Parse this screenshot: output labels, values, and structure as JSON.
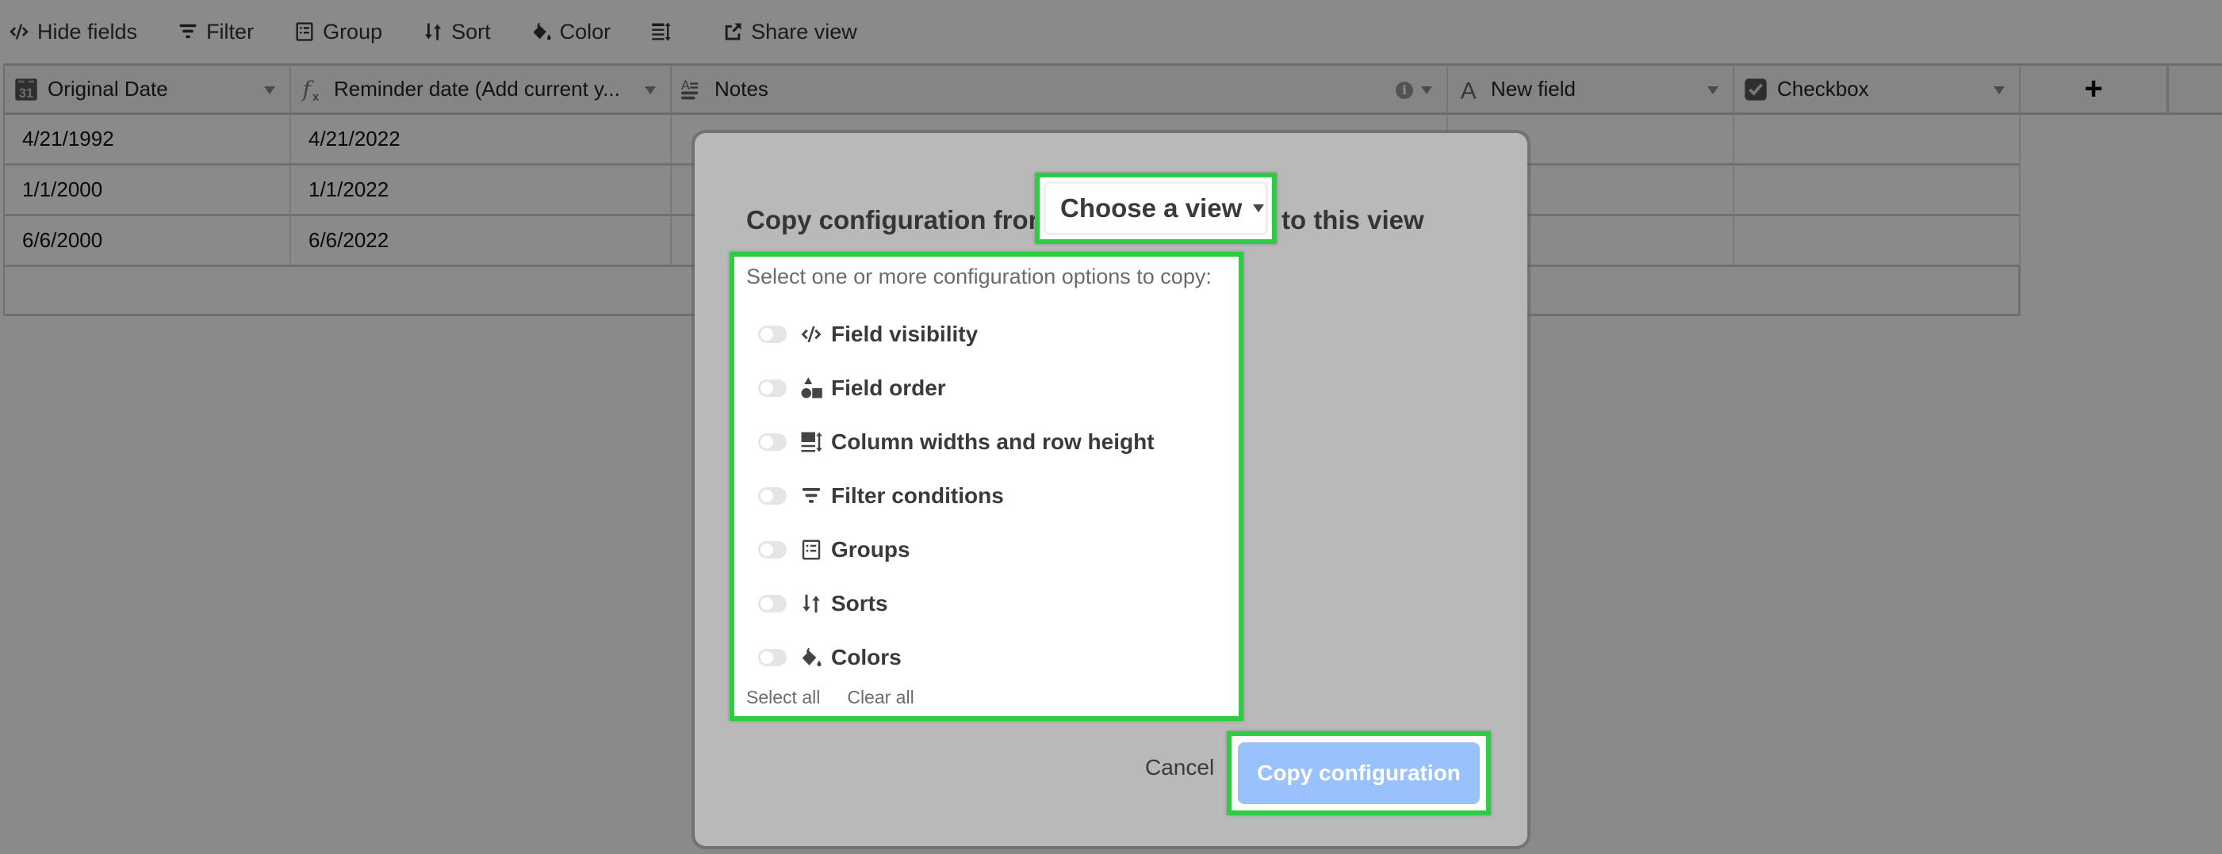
{
  "toolbar": {
    "items": [
      {
        "label": "Hide fields",
        "icon": "hide-fields-icon"
      },
      {
        "label": "Filter",
        "icon": "filter-icon"
      },
      {
        "label": "Group",
        "icon": "group-icon"
      },
      {
        "label": "Sort",
        "icon": "sort-icon"
      },
      {
        "label": "Color",
        "icon": "color-bucket-icon"
      },
      {
        "label": "",
        "icon": "row-height-icon"
      },
      {
        "label": "Share view",
        "icon": "share-icon"
      }
    ]
  },
  "table": {
    "columns": [
      {
        "label": "Original Date",
        "icon": "calendar-icon",
        "icon_text": "31"
      },
      {
        "label": "Reminder date (Add current y...",
        "icon": "formula-icon"
      },
      {
        "label": "Notes",
        "icon": "long-text-icon"
      },
      {
        "label": "New field",
        "icon": "single-line-text-icon"
      },
      {
        "label": "Checkbox",
        "icon": "checkbox-icon"
      }
    ],
    "add_column_label": "+",
    "rows": [
      [
        "4/21/1992",
        "4/21/2022",
        "",
        "",
        ""
      ],
      [
        "1/1/2000",
        "1/1/2022",
        "",
        "",
        ""
      ],
      [
        "6/6/2000",
        "6/6/2022",
        "",
        "",
        ""
      ]
    ]
  },
  "modal": {
    "title_prefix": "Copy configuration from",
    "dropdown_value": "Choose a view",
    "title_suffix": "to this view",
    "hint": "Select one or more configuration options to copy:",
    "options": [
      {
        "label": "Field visibility",
        "icon": "field-visibility-icon",
        "enabled": false
      },
      {
        "label": "Field order",
        "icon": "field-order-icon",
        "enabled": false
      },
      {
        "label": "Column widths and row height",
        "icon": "column-width-icon",
        "enabled": false
      },
      {
        "label": "Filter conditions",
        "icon": "filter-icon",
        "enabled": false
      },
      {
        "label": "Groups",
        "icon": "group-icon",
        "enabled": false
      },
      {
        "label": "Sorts",
        "icon": "sort-icon",
        "enabled": false
      },
      {
        "label": "Colors",
        "icon": "color-bucket-icon",
        "enabled": false
      }
    ],
    "select_all": "Select all",
    "clear_all": "Clear all",
    "cancel": "Cancel",
    "confirm": "Copy configuration"
  },
  "colors": {
    "highlight": "#2ecc40",
    "confirm_button": "#99c1fb",
    "toggle_off": "#e5e5e5"
  }
}
